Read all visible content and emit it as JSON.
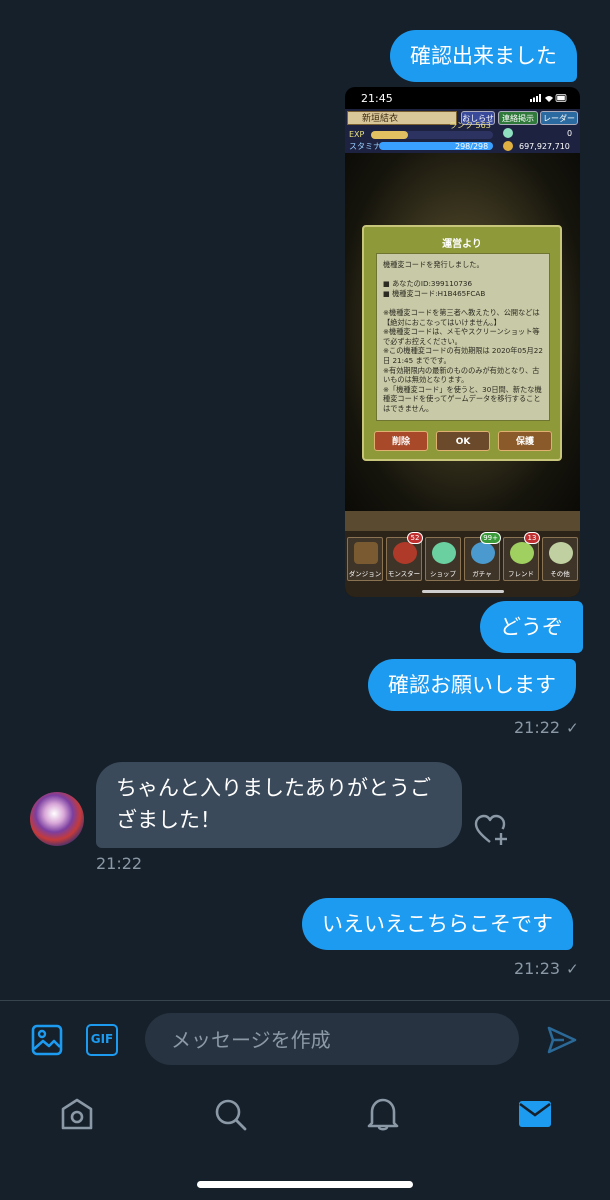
{
  "header_cut_text": "",
  "messages": {
    "out1": "確認出来ました",
    "out2": "どうぞ",
    "out3": "確認お願いします",
    "out3_time": "21:22",
    "in1_line1": "ちゃんと入りましたありがとうご",
    "in1_line2": "ざました！",
    "in1_time": "21:22",
    "out4": "いえいえこちらこそです",
    "out4_time": "21:23",
    "check": "✓"
  },
  "screenshot": {
    "status_time": "21:45",
    "player_name": "新垣結衣",
    "btn_news": "おしらせ",
    "btn_friends": "連絡掲示",
    "btn_radar": "レーダー",
    "exp_label": "EXP",
    "rank_text": "ランク 563",
    "stamina_label": "スタミナ",
    "stamina_value": "298/298",
    "stones": "0",
    "coins": "697,927,710",
    "dialog_title": "運営より",
    "dialog_body": "機種変コードを発行しました。\n\n■ あなたのID:399110736\n■ 機種変コード:H1B465FCAB\n\n※機種変コードを第三者へ教えたり、公開などは【絶対におこなってはいけません。】\n※機種変コードは、メモやスクリーンショット等で必ずお控えください。\n※この機種変コードの有効期限は 2020年05月22日 21:45 までです。\n※有効期限内の最新のもののみが有効となり、古いものは無効となります。\n※「機種変コード」を使うと、30日間、新たな機種変コードを使ってゲームデータを移行することはできません。",
    "btn_delete": "削除",
    "btn_ok": "OK",
    "btn_save": "保護",
    "tabs": [
      {
        "label": "ダンジョン",
        "badge": ""
      },
      {
        "label": "モンスター",
        "badge": "52"
      },
      {
        "label": "ショップ",
        "badge": ""
      },
      {
        "label": "ガチャ",
        "badge": "99+"
      },
      {
        "label": "フレンド",
        "badge": "13"
      },
      {
        "label": "その他",
        "badge": ""
      }
    ]
  },
  "composer": {
    "placeholder": "メッセージを作成",
    "gif_label": "GIF"
  },
  "colors": {
    "background": "#15202b",
    "accent": "#1d9bf0",
    "incoming_bubble": "#3b4a5a"
  }
}
